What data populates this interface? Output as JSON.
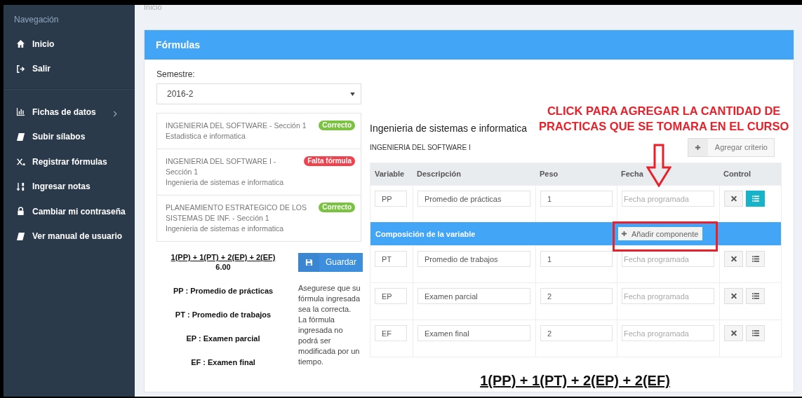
{
  "breadcrumb": "Inicio",
  "sidebar": {
    "heading": "Navegación",
    "groups": [
      [
        {
          "label": "Inicio",
          "has_submenu": false
        },
        {
          "label": "Salir",
          "has_submenu": false
        }
      ],
      [
        {
          "label": "Fichas de datos",
          "has_submenu": true
        },
        {
          "label": "Subir sílabos",
          "has_submenu": false
        },
        {
          "label": "Registrar fórmulas",
          "has_submenu": false
        },
        {
          "label": "Ingresar notas",
          "has_submenu": false
        },
        {
          "label": "Cambiar mi contraseña",
          "has_submenu": false
        },
        {
          "label": "Ver manual de usuario",
          "has_submenu": false
        }
      ]
    ]
  },
  "panel": {
    "title": "Fórmulas"
  },
  "semester": {
    "label": "Semestre:",
    "value": "2016-2"
  },
  "courses": [
    {
      "title": "INGENIERIA DEL SOFTWARE - Sección 1",
      "subtitle": "Estadistica e informatica",
      "status": "Correcto",
      "color": "#7cc242"
    },
    {
      "title": "INGENIERIA DEL SOFTWARE I - Sección 1",
      "subtitle": "Ingenieria de sistemas e informatica",
      "status": "Falta fórmula",
      "color": "#f0414c"
    },
    {
      "title": "PLANEAMIENTO ESTRATEGICO DE LOS SISTEMAS DE INF. - Sección 1",
      "subtitle": "Ingenieria de sistemas e informatica",
      "status": "Correcto",
      "color": "#7cc242"
    }
  ],
  "formula": {
    "expression": "1(PP) + 1(PT) + 2(EP) + 2(EF)",
    "total": "6.00",
    "legend": [
      "PP : Promedio de prácticas",
      "PT : Promedio de trabajos",
      "EP : Examen parcial",
      "EF : Examen final"
    ]
  },
  "save_button": "Guardar",
  "note": "Asegurese que su fórmula ingresada sea la correcta. La fórmula ingresada no podrá ser modificada por un tiempo.",
  "career": "Ingenieria de sistemas e informatica",
  "course": "INGENIERIA DEL SOFTWARE I",
  "add_criterion": "Agregar criterio",
  "columns": [
    "Variable",
    "Descripción",
    "Peso",
    "Fecha",
    "Control"
  ],
  "criteria": [
    {
      "variable": "PP",
      "description": "Promedio de prácticas",
      "weight": "1",
      "date_placeholder": "Fecha programada",
      "detail_selected": true
    }
  ],
  "composition": {
    "title": "Composición de la variable",
    "add_button": "Añadir componente"
  },
  "components": [
    {
      "variable": "PT",
      "description": "Promedio de trabajos",
      "weight": "1",
      "date_placeholder": "Fecha programada",
      "detail_selected": false
    },
    {
      "variable": "EP",
      "description": "Examen parcial",
      "weight": "2",
      "date_placeholder": "Fecha programada",
      "detail_selected": false
    },
    {
      "variable": "EF",
      "description": "Examen final",
      "weight": "2",
      "date_placeholder": "Fecha programada",
      "detail_selected": false
    }
  ],
  "bottom_formula": "1(PP) + 1(PT) + 2(EP) + 2(EF)",
  "annotation": {
    "lines": [
      "CLICK PARA AGREGAR LA CANTIDAD DE",
      "PRACTICAS QUE SE TOMARA EN EL CURSO"
    ]
  }
}
